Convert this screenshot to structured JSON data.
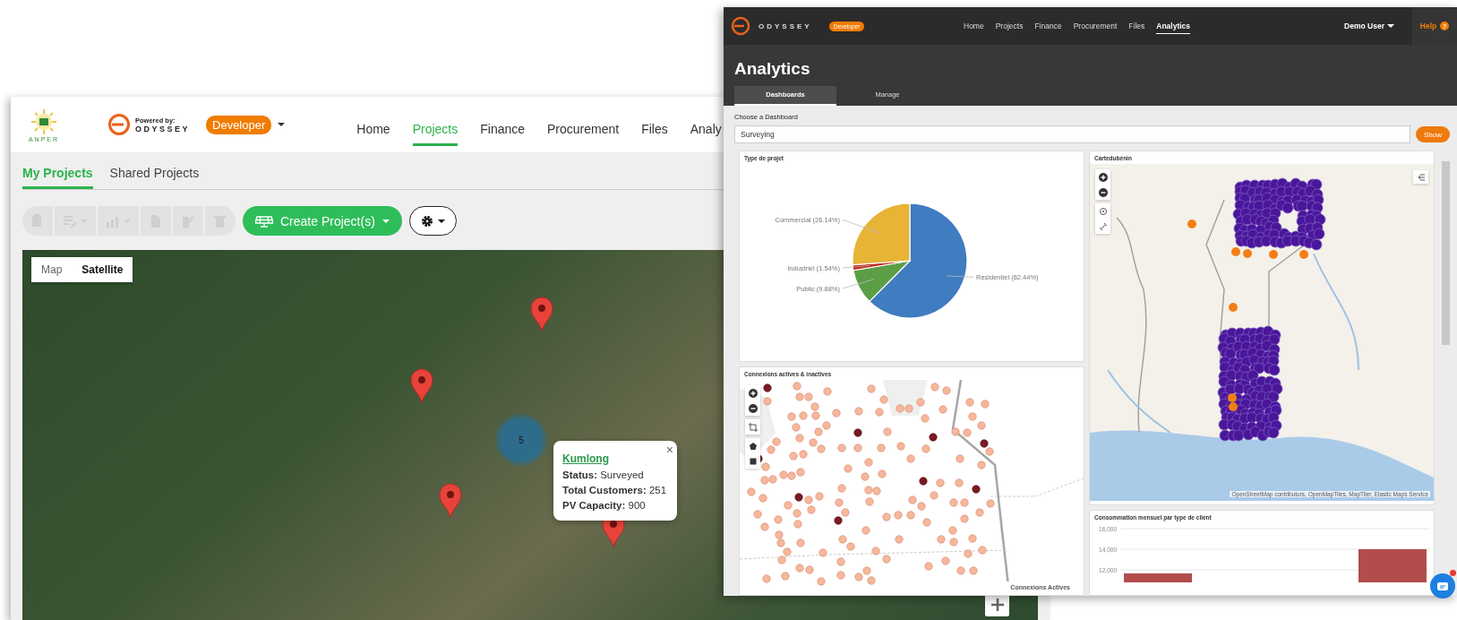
{
  "back_window": {
    "logo_text": "ANPER",
    "powered_by": "Powered by:",
    "brand": "ODYSSEY",
    "role_badge": "Developer",
    "nav": [
      {
        "label": "Home",
        "selected": false
      },
      {
        "label": "Projects",
        "selected": true
      },
      {
        "label": "Finance",
        "selected": false
      },
      {
        "label": "Procurement",
        "selected": false
      },
      {
        "label": "Files",
        "selected": false
      },
      {
        "label": "Analy",
        "selected": false
      }
    ],
    "tabs": [
      {
        "label": "My Projects",
        "selected": true
      },
      {
        "label": "Shared Projects",
        "selected": false
      }
    ],
    "toolbar": {
      "icon_buttons": [
        {
          "kind": "clipboard",
          "caret": false,
          "disabled": true
        },
        {
          "kind": "list-edit",
          "caret": true,
          "disabled": true
        },
        {
          "kind": "chart",
          "caret": true,
          "disabled": true
        },
        {
          "kind": "document",
          "caret": false,
          "disabled": true
        },
        {
          "kind": "document-edit",
          "caret": false,
          "disabled": true
        },
        {
          "kind": "trash",
          "caret": false,
          "disabled": true
        }
      ],
      "create_button": "Create Project(s)"
    },
    "map": {
      "type_toggle": [
        {
          "label": "Map",
          "selected": false
        },
        {
          "label": "Satellite",
          "selected": true
        }
      ],
      "cluster_count": "5",
      "popup": {
        "title": "Kumlong",
        "fields": [
          {
            "label": "Status:",
            "value": "Surveyed"
          },
          {
            "label": "Total Customers:",
            "value": "251"
          },
          {
            "label": "PV Capacity:",
            "value": "900"
          }
        ],
        "close": "×"
      }
    }
  },
  "front_window": {
    "brand": "ODYSSEY",
    "role_badge": "Developer",
    "nav": [
      {
        "label": "Home",
        "selected": false
      },
      {
        "label": "Projects",
        "selected": false
      },
      {
        "label": "Finance",
        "selected": false
      },
      {
        "label": "Procurement",
        "selected": false
      },
      {
        "label": "Files",
        "selected": false
      },
      {
        "label": "Analytics",
        "selected": true
      }
    ],
    "user_menu": "Demo User",
    "help": "Help",
    "help_badge": "?",
    "page_title": "Analytics",
    "tabs": [
      {
        "label": "Dashboards",
        "selected": true
      },
      {
        "label": "Manage",
        "selected": false
      }
    ],
    "dashboard_picker": {
      "label": "Choose a Dashboard",
      "value": "Surveying",
      "button": "Show"
    },
    "panels": [
      {
        "kind": "pie",
        "title": "Type de projet",
        "chart_data": {
          "type": "pie",
          "values": [
            62.44,
            9.88,
            1.54,
            26.14
          ],
          "colors": [
            "#3f7cc0",
            "#5c9e46",
            "#c22a1c",
            "#e7b436"
          ],
          "value_labels": [
            "Residentiel (62.44%)",
            "Public (9.88%)",
            "Industriel (1.54%)",
            "Commercial (26.14%)"
          ]
        }
      },
      {
        "kind": "points-map",
        "title": "Cartedubénin",
        "attribution": "OpenStreetMap contributors, OpenMapTiles, MapTiler, Elastic Maps Service"
      },
      {
        "kind": "connections-map",
        "title": "Connexions actives & inactives",
        "legend_title": "Connexions Actives"
      },
      {
        "kind": "bar",
        "title": "Consommation mensuel par type de client",
        "tick_labels": [
          "16,000",
          "14,000",
          "12,000"
        ]
      }
    ]
  }
}
